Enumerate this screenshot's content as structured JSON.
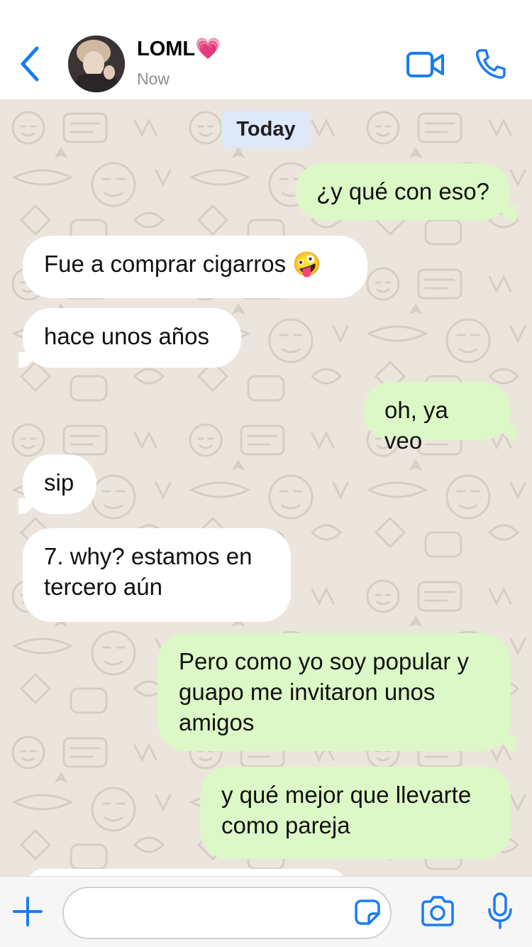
{
  "header": {
    "back_icon": "chevron-left-icon",
    "contact_name": "LOML💗",
    "status": "Now",
    "video_icon": "video-camera-icon",
    "call_icon": "phone-icon",
    "accent_color": "#1a7cf5"
  },
  "chat": {
    "date_label": "Today",
    "wallpaper": "whatsapp-doodle-pattern",
    "messages": [
      {
        "direction": "out",
        "text": "¿y qué con eso?"
      },
      {
        "direction": "in",
        "text": "Fue a comprar cigarros 🤪"
      },
      {
        "direction": "in",
        "text": "hace unos años"
      },
      {
        "direction": "out",
        "text": "oh, ya veo"
      },
      {
        "direction": "in",
        "text": "sip"
      },
      {
        "direction": "in",
        "text": "7. why? estamos en tercero aún"
      },
      {
        "direction": "out",
        "text": "Pero como yo soy popular y guapo me invitaron unos amigos"
      },
      {
        "direction": "out",
        "text": "y qué mejor que llevarte como pareja"
      }
    ],
    "incoming_color": "#ffffff",
    "outgoing_color": "#dcf8c6",
    "background_color": "#ece5dd"
  },
  "input_bar": {
    "plus_icon": "plus-icon",
    "message_value": "",
    "sticker_icon": "sticker-icon",
    "camera_icon": "camera-icon",
    "mic_icon": "microphone-icon"
  }
}
